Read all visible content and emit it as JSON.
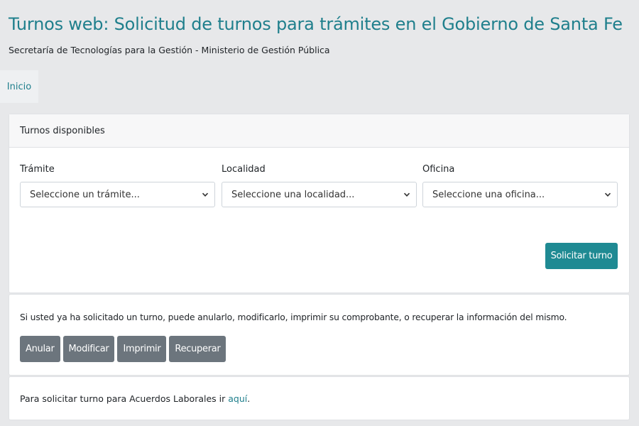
{
  "header": {
    "title": "Turnos web: Solicitud de turnos para trámites en el Gobierno de Santa Fe",
    "subtitle": "Secretaría de Tecnologías para la Gestión - Ministerio de Gestión Pública"
  },
  "nav": {
    "home_label": "Inicio"
  },
  "main_card": {
    "header": "Turnos disponibles",
    "fields": {
      "tramite": {
        "label": "Trámite",
        "value": "Seleccione un trámite..."
      },
      "localidad": {
        "label": "Localidad",
        "value": "Seleccione una localidad..."
      },
      "oficina": {
        "label": "Oficina",
        "value": "Seleccione una oficina..."
      }
    },
    "submit_label": "Solicitar turno"
  },
  "actions_card": {
    "text": "Si usted ya ha solicitado un turno, puede anularlo, modificarlo, imprimir su comprobante, o recuperar la información del mismo.",
    "buttons": {
      "anular": "Anular",
      "modificar": "Modificar",
      "imprimir": "Imprimir",
      "recuperar": "Recuperar"
    }
  },
  "footer_card": {
    "text_prefix": "Para solicitar turno para Acuerdos Laborales ir ",
    "link_label": "aquí",
    "text_suffix": "."
  },
  "colors": {
    "accent": "#1f7f8c",
    "primary_button": "#1f8a93",
    "secondary_button": "#6c757d",
    "background": "#e7e8ea"
  },
  "icons": {
    "select_arrow": "chevron-down-icon"
  }
}
